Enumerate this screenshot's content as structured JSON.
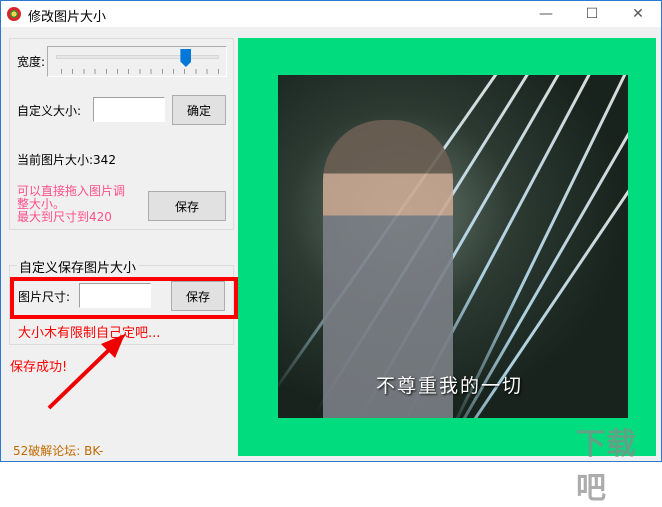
{
  "window": {
    "title": "修改图片大小",
    "minimize": "—",
    "maximize": "☐",
    "close": "✕"
  },
  "width_label": "宽度:",
  "slider": {
    "value_fraction": 0.8
  },
  "custom_size": {
    "label": "自定义大小:",
    "value": "",
    "confirm": "确定"
  },
  "current_size": {
    "label": "当前图片大小:",
    "value": "342"
  },
  "hint": {
    "line1": "可以直接拖入图片调",
    "line2": "整大小。",
    "line3": "最大到尺寸到420"
  },
  "save_button": "保存",
  "custom_save_group": {
    "title": "自定义保存图片大小",
    "size_label": "图片尺寸:",
    "value": "",
    "save": "保存",
    "note": "大小木有限制自己定吧..."
  },
  "status": "保存成功!",
  "credit": "52破解论坛:  BK-",
  "image": {
    "subtitle": "不尊重我的一切",
    "background_color": "#00dc7e"
  },
  "watermark": "下载吧"
}
